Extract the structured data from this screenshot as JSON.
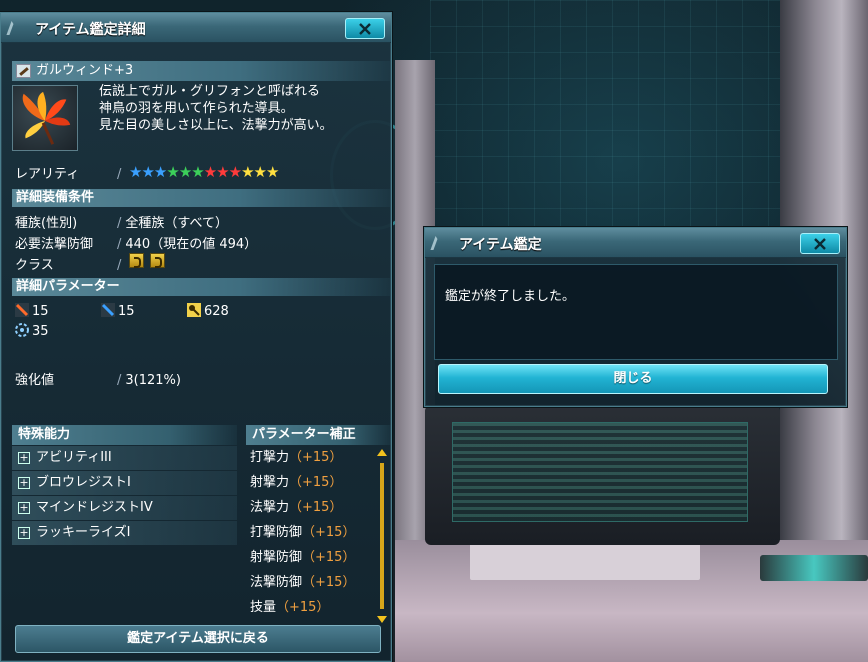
{
  "detail_window": {
    "title": "アイテム鑑定詳細",
    "item_name": "ガルウィンド+3",
    "description": [
      "伝説上でガル・グリフォンと呼ばれる",
      "神鳥の羽を用いて作られた導具。",
      "見た目の美しさ以上に、法撃力が高い。"
    ],
    "rarity_label": "レアリティ",
    "rarity_stars": [
      {
        "color": "#3aa0ff"
      },
      {
        "color": "#3aa0ff"
      },
      {
        "color": "#3aa0ff"
      },
      {
        "color": "#3cd05a"
      },
      {
        "color": "#3cd05a"
      },
      {
        "color": "#3cd05a"
      },
      {
        "color": "#ff3b3b"
      },
      {
        "color": "#ff3b3b"
      },
      {
        "color": "#ff3b3b"
      },
      {
        "color": "#ffe040"
      },
      {
        "color": "#ffe040"
      },
      {
        "color": "#ffe040"
      }
    ],
    "equip_head": "詳細装備条件",
    "race_label": "種族(性別)",
    "race_value": "全種族（すべて）",
    "req_label": "必要法撃防御",
    "req_value": "440（現在の値 494）",
    "class_label": "クラス",
    "params_head": "詳細パラメーター",
    "params": [
      {
        "icon": "sword-icon",
        "value": "15"
      },
      {
        "icon": "gun-icon",
        "value": "15"
      },
      {
        "icon": "wand-icon",
        "value": "628"
      },
      {
        "icon": "gear-icon",
        "value": "35"
      }
    ],
    "enhance_label": "強化値",
    "enhance_value": "3(121%)",
    "abilities_head": "特殊能力",
    "abilities": [
      "アビリティIII",
      "ブロウレジストI",
      "マインドレジストIV",
      "ラッキーライズI"
    ],
    "param_bonus_head": "パラメーター補正",
    "param_bonus": [
      {
        "name": "打撃力",
        "value": "（+15）"
      },
      {
        "name": "射撃力",
        "value": "（+15）"
      },
      {
        "name": "法撃力",
        "value": "（+15）"
      },
      {
        "name": "打撃防御",
        "value": "（+15）"
      },
      {
        "name": "射撃防御",
        "value": "（+15）"
      },
      {
        "name": "法撃防御",
        "value": "（+15）"
      },
      {
        "name": "技量",
        "value": "（+15）"
      }
    ],
    "back_button": "鑑定アイテム選択に戻る"
  },
  "dialog": {
    "title": "アイテム鑑定",
    "message": "鑑定が終了しました。",
    "close_button": "閉じる"
  },
  "colors": {
    "accent": "#22b4d4",
    "bonus_value": "#f0a040",
    "scroll": "#f2c21e"
  }
}
